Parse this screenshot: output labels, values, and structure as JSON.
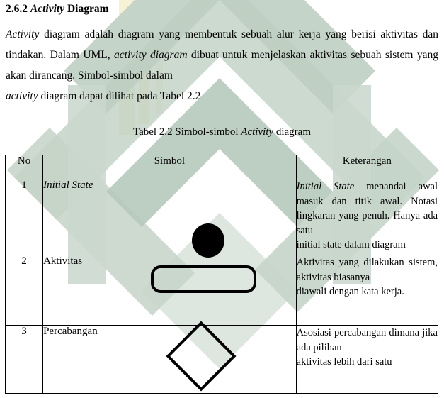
{
  "document": {
    "section_number": "2.6.2",
    "section_title_italic": "Activity",
    "section_title_rest": "Diagram",
    "body_paragraph": {
      "line1_italic": "Activity",
      "line1_rest": "diagram adalah diagram yang membentuk sebuah alur kerja yang berisi aktivitas dan tindakan. Dalam UML,",
      "mid_italic": "activity diagram",
      "line2_rest": "dibuat untuk menjelaskan aktivitas sebuah sistem yang akan dirancang. Simbol-simbol dalam",
      "line3_italic": "activity",
      "line3_rest": "diagram dapat dilihat pada Tabel 2.2"
    },
    "table_caption": {
      "prefix": "Tabel 2.2 Simbol-simbol",
      "italic": "Activity",
      "suffix": "diagram"
    }
  },
  "table": {
    "headers": {
      "no": "No",
      "simbol": "Simbol",
      "keterangan": "Keterangan"
    },
    "rows": [
      {
        "no": "1",
        "symbol_label": "Initial State",
        "symbol_label_italic": true,
        "symbol_shape": "filled-circle",
        "keterangan_italic": "Initial State",
        "keterangan_rest": "menandai awal masuk dan titik awal. Notasi lingkaran yang penuh. Hanya ada satu",
        "keterangan_last": "initial state dalam diagram"
      },
      {
        "no": "2",
        "symbol_label": "Aktivitas",
        "symbol_label_italic": false,
        "symbol_shape": "rounded-rectangle",
        "keterangan_italic": "",
        "keterangan_rest": "Aktivitas yang dilakukan sistem, aktivitas biasanya",
        "keterangan_last": "diawali dengan kata kerja."
      },
      {
        "no": "3",
        "symbol_label": "Percabangan",
        "symbol_label_italic": false,
        "symbol_shape": "diamond",
        "keterangan_italic": "",
        "keterangan_rest": "Asosiasi percabangan dimana jika ada pilihan",
        "keterangan_last": "aktivitas lebih dari satu"
      }
    ]
  },
  "watermark": {
    "primary_color": "#c5d4c8",
    "secondary_color": "#b3c6ba",
    "accent_color": "#f2ecc9",
    "description": "university logo chevron diamond watermark"
  }
}
